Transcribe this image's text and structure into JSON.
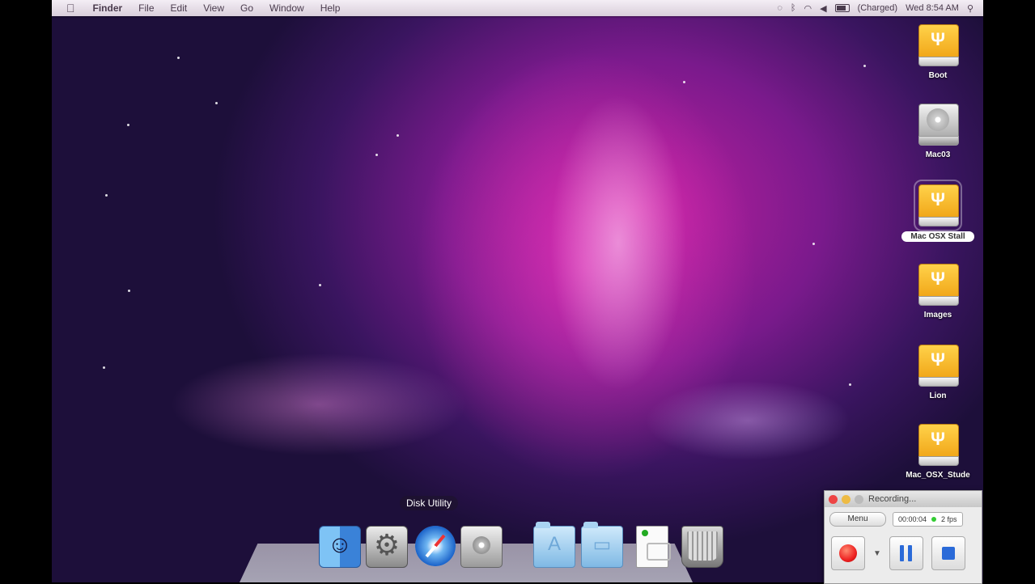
{
  "menubar": {
    "apple": "",
    "app": "Finder",
    "menus": [
      "File",
      "Edit",
      "View",
      "Go",
      "Window",
      "Help"
    ],
    "battery": "(Charged)",
    "clock": "Wed 8:54 AM"
  },
  "desktop": {
    "icons": [
      {
        "label": "Boot",
        "kind": "usb"
      },
      {
        "label": "Mac03",
        "kind": "hdd"
      },
      {
        "label": "Mac OSX Stall",
        "kind": "usb",
        "selected": true
      },
      {
        "label": "Images",
        "kind": "usb"
      },
      {
        "label": "Lion",
        "kind": "usb"
      },
      {
        "label": "Mac_OSX_Stude",
        "kind": "usb"
      }
    ]
  },
  "dock": {
    "tooltip": "Disk Utility",
    "items": [
      "finder-icon",
      "system-preferences-icon",
      "safari-icon",
      "disk-utility-icon",
      "applications-folder-icon",
      "documents-folder-icon",
      "document-icon",
      "trash-icon"
    ]
  },
  "recorder": {
    "title": "Recording...",
    "menu_label": "Menu",
    "time": "00:00:04",
    "fps": "2 fps"
  }
}
